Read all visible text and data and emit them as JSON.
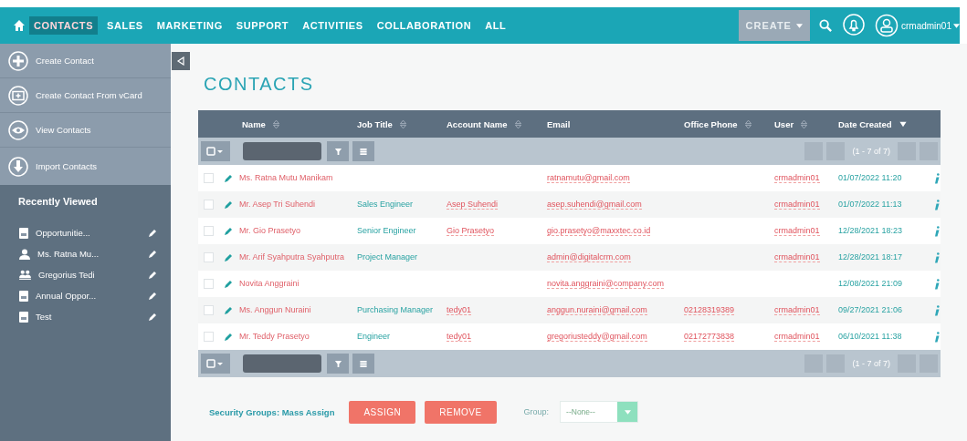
{
  "nav": {
    "tabs": [
      {
        "label": "CONTACTS",
        "selected": true
      },
      {
        "label": "SALES",
        "selected": false
      },
      {
        "label": "MARKETING",
        "selected": false
      },
      {
        "label": "SUPPORT",
        "selected": false
      },
      {
        "label": "ACTIVITIES",
        "selected": false
      },
      {
        "label": "COLLABORATION",
        "selected": false
      },
      {
        "label": "ALL",
        "selected": false
      }
    ],
    "create": "CREATE",
    "user": "crmadmin01"
  },
  "sidebar": {
    "actions": [
      {
        "kind": "plus",
        "label": "Create Contact"
      },
      {
        "kind": "vcard",
        "label": "Create Contact From vCard"
      },
      {
        "kind": "eye",
        "label": "View Contacts"
      },
      {
        "kind": "import",
        "label": "Import Contacts"
      }
    ],
    "recent_title": "Recently Viewed",
    "recent": [
      {
        "kind": "document",
        "label": "Opportunitie..."
      },
      {
        "kind": "person",
        "label": "Ms. Ratna Mu..."
      },
      {
        "kind": "group",
        "label": "Gregorius Tedi"
      },
      {
        "kind": "document",
        "label": "Annual Oppor..."
      },
      {
        "kind": "document",
        "label": "Test"
      }
    ]
  },
  "page_title": "CONTACTS",
  "table": {
    "columns": [
      {
        "label": "Name",
        "sortable": true,
        "sorted": false
      },
      {
        "label": "Job Title",
        "sortable": true,
        "sorted": false
      },
      {
        "label": "Account Name",
        "sortable": true,
        "sorted": false
      },
      {
        "label": "Email",
        "sortable": false,
        "sorted": false
      },
      {
        "label": "Office Phone",
        "sortable": true,
        "sorted": false
      },
      {
        "label": "User",
        "sortable": true,
        "sorted": false
      },
      {
        "label": "Date Created",
        "sortable": true,
        "sorted": true
      }
    ],
    "pagination_top": "(1 - 7 of 7)",
    "pagination_bottom": "(1 - 7 of 7)",
    "rows": [
      {
        "checked": false,
        "name": "Ms. Ratna Mutu Manikam",
        "job": "",
        "account": "",
        "email": "ratnamutu@gmail.com",
        "phone": "",
        "user": "crmadmin01",
        "date": "01/07/2022 11:20"
      },
      {
        "checked": false,
        "name": "Mr. Asep Tri Suhendi",
        "job": "Sales Engineer",
        "account": "Asep Suhendi",
        "email": "asep.suhendi@gmail.com",
        "phone": "",
        "user": "crmadmin01",
        "date": "01/07/2022 11:13"
      },
      {
        "checked": false,
        "name": "Mr. Gio Prasetyo",
        "job": "Senior Engineer",
        "account": "Gio Prasetyo",
        "email": "gio.prasetyo@maxxtec.co.id",
        "phone": "",
        "user": "crmadmin01",
        "date": "12/28/2021 18:23"
      },
      {
        "checked": false,
        "name": "Mr. Arif Syahputra Syahputra",
        "job": "Project Manager",
        "account": "",
        "email": "admin@digitalcrm.com",
        "phone": "",
        "user": "crmadmin01",
        "date": "12/28/2021 18:17"
      },
      {
        "checked": false,
        "name": "Novita Anggraini",
        "job": "",
        "account": "",
        "email": "novita.anggraini@company.com",
        "phone": "",
        "user": "",
        "date": "12/08/2021 21:09"
      },
      {
        "checked": false,
        "name": "Ms. Anggun Nuraini",
        "job": "Purchasing Manager",
        "account": "tedy01",
        "email": "anggun.nuraini@gmail.com",
        "phone": "02128319389",
        "user": "crmadmin01",
        "date": "09/27/2021 21:06"
      },
      {
        "checked": false,
        "name": "Mr. Teddy Prasetyo",
        "job": "Engineer",
        "account": "tedy01",
        "email": "gregoriusteddy@gmail.com",
        "phone": "02172773838",
        "user": "crmadmin01",
        "date": "06/10/2021 11:38"
      }
    ]
  },
  "mass_assign": {
    "label": "Security Groups: Mass Assign",
    "assign": "ASSIGN",
    "remove": "REMOVE",
    "group_label": "Group:",
    "group_value": "--None--"
  }
}
